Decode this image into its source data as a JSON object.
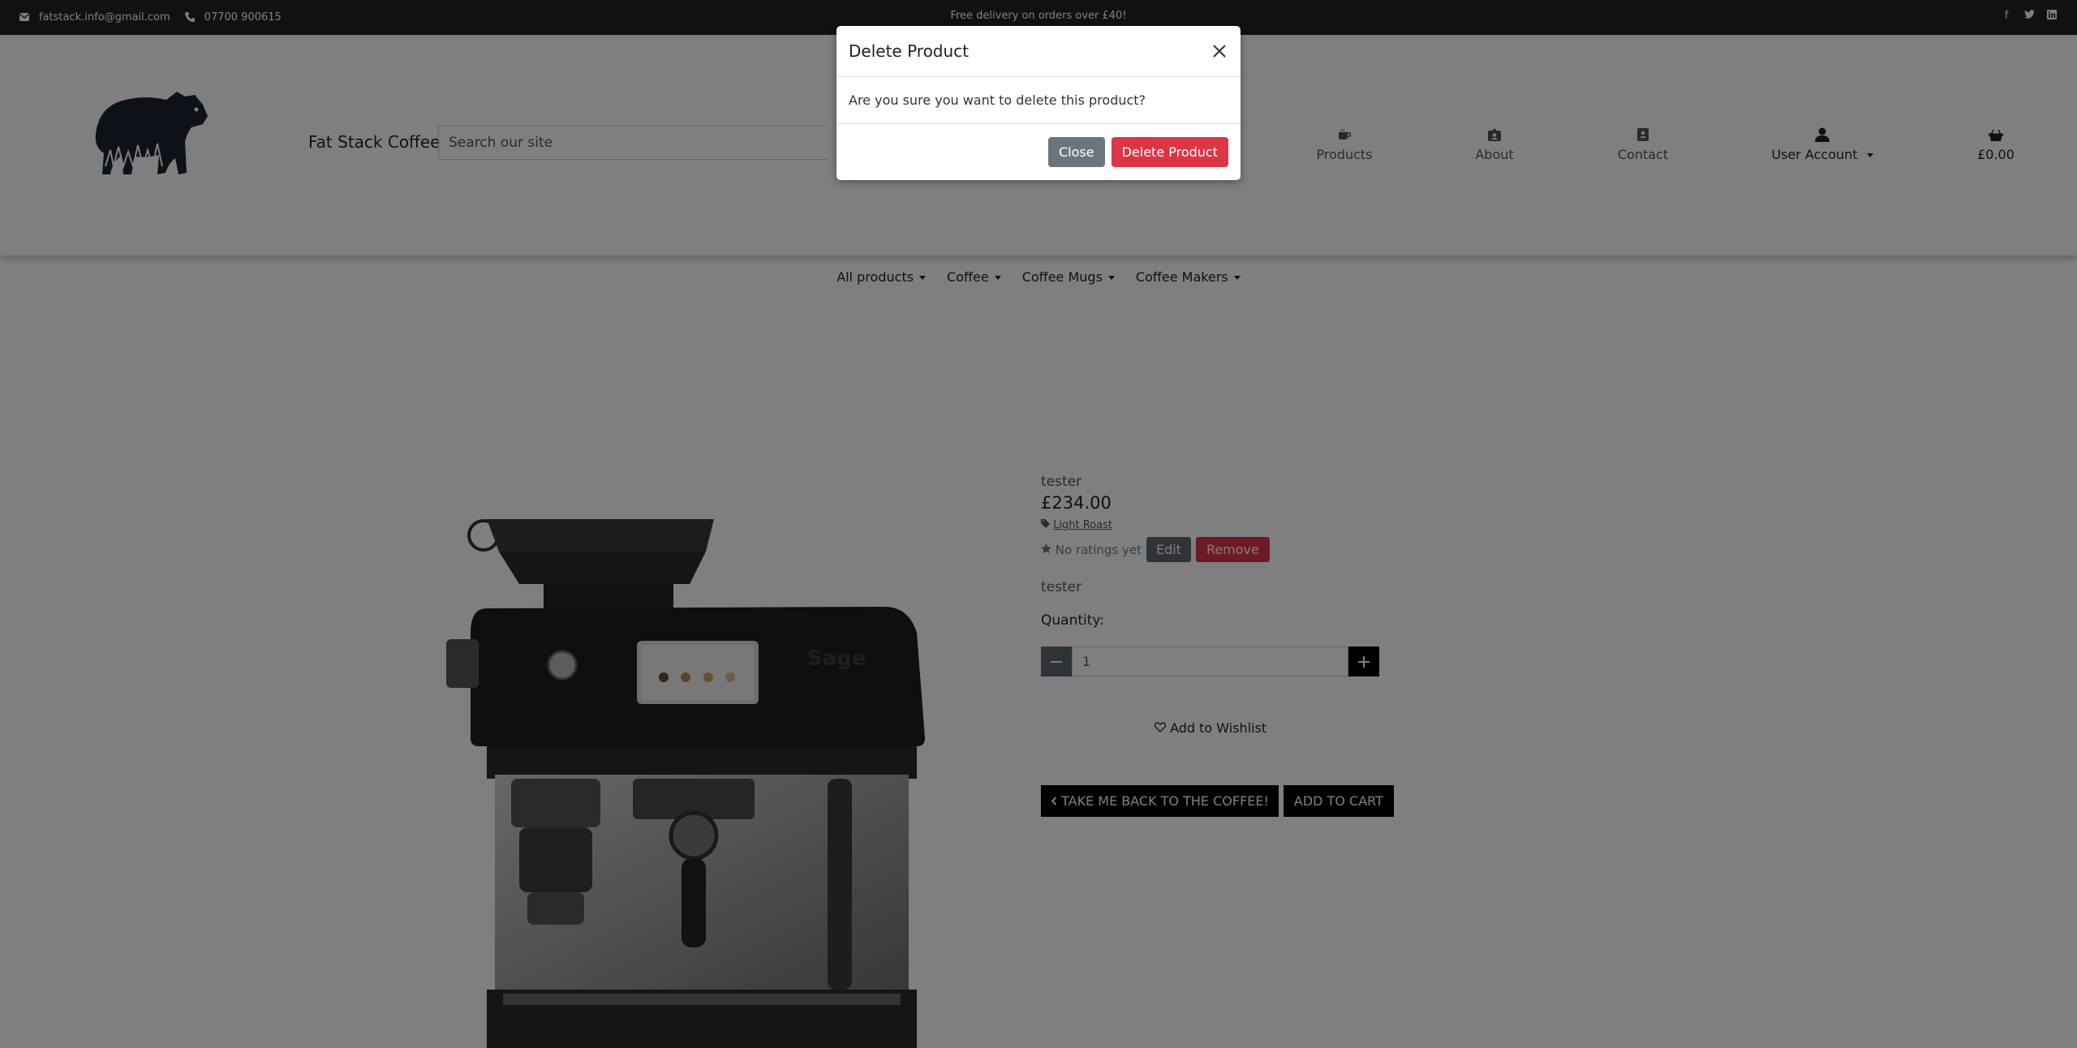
{
  "topbar": {
    "email": "fatstack.info@gmail.com",
    "phone": "07700 900615",
    "promo": "Free delivery on orders over £40!",
    "social": [
      "facebook-icon",
      "twitter-icon",
      "linkedin-icon"
    ]
  },
  "header": {
    "brand": "Fat Stack Coffee",
    "search_placeholder": "Search our site",
    "nav": {
      "products": "Products",
      "about": "About",
      "contact": "Contact",
      "account": "User Account",
      "basket_total": "£0.00"
    }
  },
  "categories": [
    "All products",
    "Coffee",
    "Coffee Mugs",
    "Coffee Makers"
  ],
  "product": {
    "name": "tester",
    "price": "£234.00",
    "category": "Light Roast",
    "rating": "No ratings yet",
    "edit_label": "Edit",
    "remove_label": "Remove",
    "description": "tester",
    "quantity_label": "Quantity:",
    "quantity": "1",
    "wishlist_label": "Add to Wishlist",
    "back_label": "TAKE ME BACK TO THE COFFEE!",
    "cart_label": "ADD TO CART"
  },
  "modal": {
    "title": "Delete Product",
    "body": "Are you sure you want to delete this product?",
    "close_label": "Close",
    "delete_label": "Delete Product"
  },
  "colors": {
    "danger": "#dc3545",
    "secondary": "#6c757d",
    "topbar": "#222222"
  }
}
